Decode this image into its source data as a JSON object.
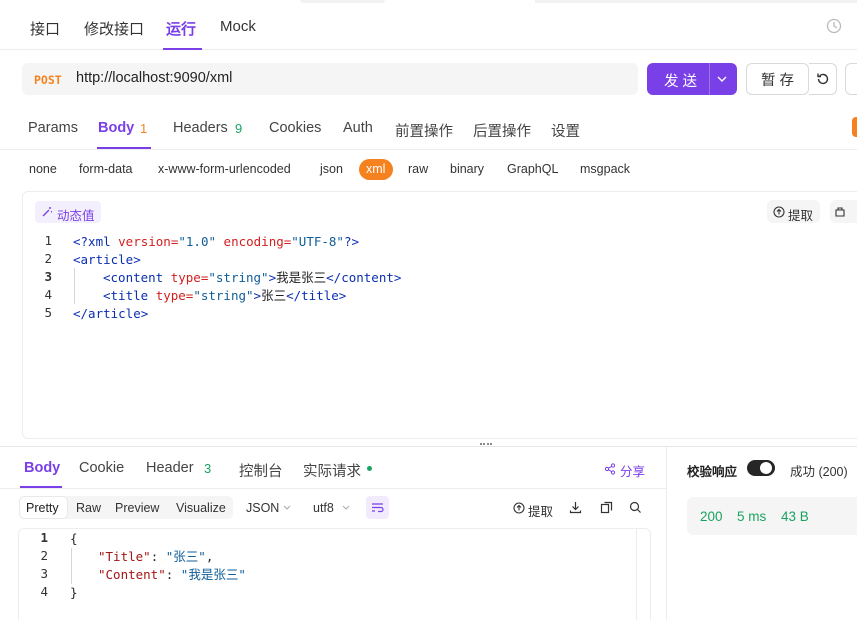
{
  "top_tabs": [
    "接口",
    "修改接口",
    "运行",
    "Mock"
  ],
  "request": {
    "method": "POST",
    "url": "http://localhost:9090/xml",
    "send_label": "发 送",
    "save_label": "暂 存"
  },
  "sub_tabs": {
    "params": "Params",
    "body": "Body",
    "body_count": "1",
    "headers": "Headers",
    "headers_count": "9",
    "cookies": "Cookies",
    "auth": "Auth",
    "pre": "前置操作",
    "post": "后置操作",
    "settings": "设置"
  },
  "body_types": [
    "none",
    "form-data",
    "x-www-form-urlencoded",
    "json",
    "xml",
    "raw",
    "binary",
    "GraphQL",
    "msgpack"
  ],
  "editor": {
    "dynamic_value": "动态值",
    "extract": "提取",
    "line_numbers": [
      "1",
      "2",
      "3",
      "4",
      "5"
    ],
    "lines": {
      "l1_open": "<?xml ",
      "l1_attr1": "version=",
      "l1_val1": "\"1.0\"",
      "l1_attr2": " encoding=",
      "l1_val2": "\"UTF-8\"",
      "l1_close": "?>",
      "l2": "<article>",
      "l3_open": "<content ",
      "l3_attr": "type=",
      "l3_val": "\"string\"",
      "l3_gt": ">",
      "l3_text": "我是张三",
      "l3_close": "</content>",
      "l4_open": "<title ",
      "l4_attr": "type=",
      "l4_val": "\"string\"",
      "l4_gt": ">",
      "l4_text": "张三",
      "l4_close": "</title>",
      "l5": "</article>"
    }
  },
  "response": {
    "tabs": {
      "body": "Body",
      "cookie": "Cookie",
      "header": "Header",
      "header_count": "3",
      "console": "控制台",
      "actual": "实际请求"
    },
    "share": "分享",
    "views": [
      "Pretty",
      "Raw",
      "Preview",
      "Visualize"
    ],
    "format": "JSON",
    "encoding": "utf8",
    "extract": "提取",
    "line_numbers": [
      "1",
      "2",
      "3",
      "4"
    ],
    "json": {
      "open": "{",
      "k1": "\"Title\"",
      "v1": "\"张三\"",
      "k2": "\"Content\"",
      "v2": "\"我是张三\"",
      "close": "}"
    }
  },
  "validate": {
    "label": "校验响应",
    "result": "成功 (200)",
    "status": "200",
    "time": "5 ms",
    "size": "43 B"
  },
  "colors": {
    "accent": "#7a40e8",
    "xml_orange": "#f5821f",
    "success_green": "#1aa360"
  }
}
